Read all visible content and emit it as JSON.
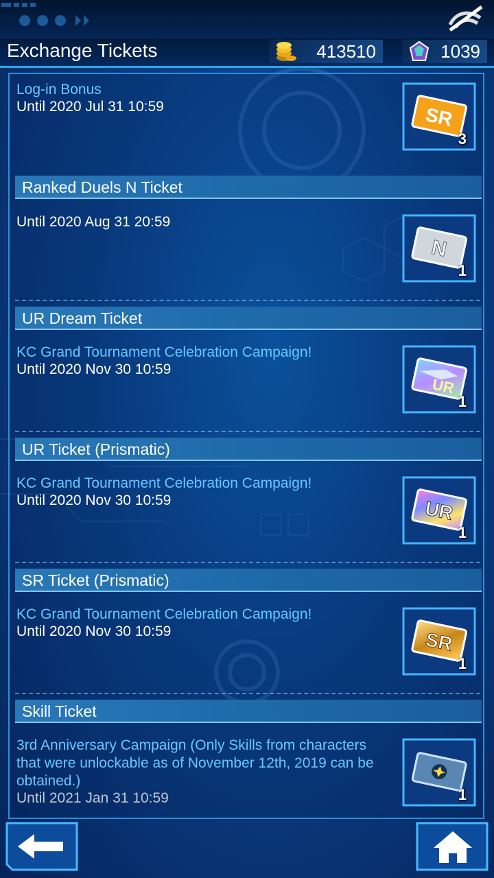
{
  "header": {
    "title": "Exchange Tickets",
    "coins": "413510",
    "gems": "1039"
  },
  "tickets": [
    {
      "name": "Log-in Bonus",
      "campaign": "",
      "until": "Until 2020 Jul 31 10:59",
      "badge": "SR",
      "count": "3",
      "color": "#f5a21a"
    },
    {
      "name": "Ranked Duels N Ticket",
      "campaign": "",
      "until": "Until 2020 Aug 31 20:59",
      "badge": "N",
      "count": "1",
      "color": "#cfd6dc"
    },
    {
      "name": "UR Dream Ticket",
      "campaign": "KC Grand Tournament Celebration Campaign!",
      "until": "Until 2020 Nov 30 10:59",
      "badge": "UR",
      "count": "1",
      "color": "#8fc8ff"
    },
    {
      "name": "UR Ticket (Prismatic)",
      "campaign": "KC Grand Tournament Celebration Campaign!",
      "until": "Until 2020 Nov 30 10:59",
      "badge": "UR",
      "count": "1",
      "color": "#b77cff"
    },
    {
      "name": "SR Ticket (Prismatic)",
      "campaign": "KC Grand Tournament Celebration Campaign!",
      "until": "Until 2020 Nov 30 10:59",
      "badge": "SR",
      "count": "1",
      "color": "#e0a52a"
    },
    {
      "name": "Skill Ticket",
      "campaign": "3rd Anniversary Campaign (Only Skills from characters that were unlockable as of November 12th, 2019 can be obtained.)",
      "until": "Until 2021 Jan 31 10:59",
      "badge": "",
      "count": "1",
      "color": "#5a86b4"
    }
  ],
  "icons": {
    "coins": "gold-coins-icon",
    "gems": "gem-icon",
    "network": "no-connection-icon",
    "back": "back-arrow-icon",
    "home": "home-icon"
  }
}
